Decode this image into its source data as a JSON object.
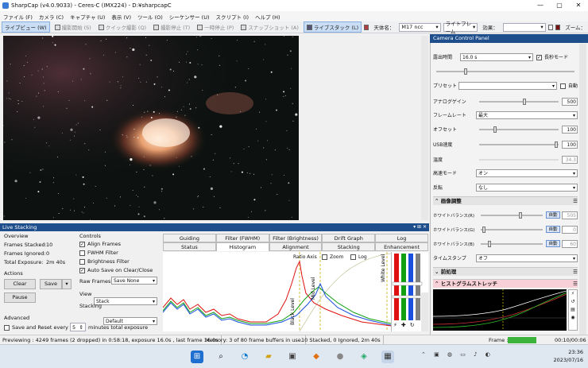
{
  "window": {
    "title": "SharpCap (v4.0.9033) - Ceres-C (IMX224) - D:¥sharpcapC",
    "min": "—",
    "max": "▢",
    "close": "✕"
  },
  "menu": [
    "ファイル (F)",
    "カメラ (C)",
    "キャプチャ (U)",
    "表示 (V)",
    "ツール (O)",
    "シーケンサー (U)",
    "スクリプト (I)",
    "ヘルプ (H)"
  ],
  "toolbar": {
    "items": [
      "ライブビュー (W)",
      "撮影開始 (S)",
      "クイック撮影 (Q)",
      "撮影停止 (T)",
      "一時停止 (P)",
      "スナップショット (A)",
      "ライブスタック (L)"
    ],
    "target_label": "天体名：",
    "target_value": "M17 ncc",
    "frame_mode": "ライトフレーム",
    "effect_label": "効果：",
    "zoom_label": "ズーム："
  },
  "camera_panel": {
    "title": "Camera Control Panel",
    "exposure_label": "露出時間",
    "exposure_value": "16.0 s",
    "long_mode": "長秒モード",
    "preset_label": "プリセット",
    "auto_label": "自動",
    "controls": [
      {
        "label": "アナログゲイン",
        "value": "500"
      },
      {
        "label": "フレームレート",
        "value": "最大"
      },
      {
        "label": "オフセット",
        "value": "100"
      },
      {
        "label": "USB速度",
        "value": "100"
      },
      {
        "label": "温度",
        "value": "34.3"
      },
      {
        "label": "高速モード",
        "value": "オン"
      },
      {
        "label": "反転",
        "value": "なし"
      }
    ],
    "sec_image": "画像調整",
    "wb": [
      {
        "label": "ホワイトバランス(R)",
        "auto": "自動",
        "value": "505"
      },
      {
        "label": "ホワイトバランス(G)",
        "auto": "自動",
        "value": "0"
      },
      {
        "label": "ホワイトバランス(B)",
        "auto": "自動",
        "value": "60"
      }
    ],
    "timestamp_label": "タイムスタンプ",
    "timestamp_value": "オフ",
    "sec_pre": "前処理",
    "sec_hist": "ヒストグラムストレッチ"
  },
  "live_stacking": {
    "title": "Live Stacking",
    "overview": "Overview",
    "stacked_label": "Frames Stacked:",
    "stacked": "10",
    "ignored_label": "Frames Ignored:",
    "ignored": "0",
    "exposure_label": "Total Exposure:",
    "exposure": "2m 40s",
    "actions": "Actions",
    "clear": "Clear",
    "save": "Save",
    "pause": "Pause",
    "advanced": "Advanced",
    "save_reset": "Save and Reset every",
    "every_value": "5",
    "every_unit": "minutes total exposure",
    "controls": "Controls",
    "align": "Align Frames",
    "fwhm": "FWHM Filter",
    "brightness": "Brightness Filter",
    "autosave": "Auto Save on Clear/Close",
    "raw_label": "Raw Frames",
    "raw_value": "Save None",
    "view_label": "View",
    "view_value": "Stack",
    "stacking_label": "Stacking",
    "stacking_value": "Default",
    "tabs_top": [
      "Guiding",
      "Filter (FWHM)",
      "Filter (Brightness)",
      "Drift Graph",
      "Log"
    ],
    "tabs_bottom": [
      "Status",
      "Histogram",
      "Alignment",
      "Stacking",
      "Enhancement"
    ],
    "hist_labels": {
      "ratio": "Ratio Axis",
      "zoom": "Zoom",
      "log": "Log",
      "black": "Black Level",
      "mid": "Mid Level",
      "white": "White Level"
    }
  },
  "status": {
    "preview": "Previewing : 4249 frames (2 dropped) in 0:58:18, exposure 16.0s , last frame 16.0s",
    "memory": "Memory: 3 of 80 frame buffers in use.",
    "stack": "10 Stacked, 0 Ignored, 2m 40s",
    "frame_label": "Frame :",
    "time": "00:10/00:06"
  },
  "taskbar": {
    "clock": "23:36",
    "date": "2023/07/16"
  },
  "colors": {
    "accent": "#1e4e8c",
    "histo_red": "#e01010",
    "histo_green": "#10a010",
    "histo_blue": "#1a4fe0"
  }
}
